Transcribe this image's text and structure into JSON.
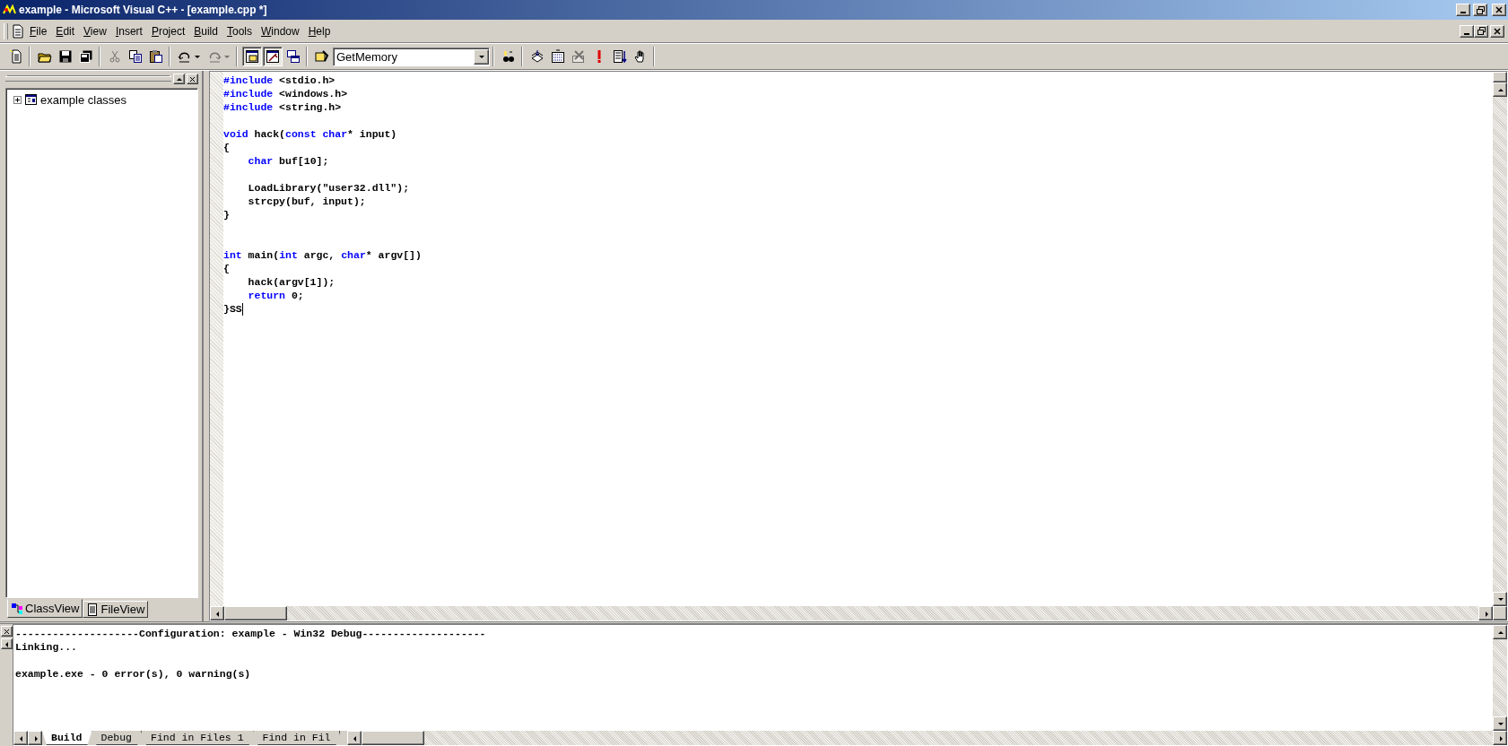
{
  "window": {
    "title": "example - Microsoft Visual C++ - [example.cpp *]"
  },
  "menu": [
    {
      "label": "File"
    },
    {
      "label": "Edit"
    },
    {
      "label": "View"
    },
    {
      "label": "Insert"
    },
    {
      "label": "Project"
    },
    {
      "label": "Build"
    },
    {
      "label": "Tools"
    },
    {
      "label": "Window"
    },
    {
      "label": "Help"
    }
  ],
  "toolbar": {
    "groups": [
      [
        {
          "kind": "button",
          "disabled": false,
          "pressed": false
        }
      ],
      [
        {
          "kind": "button",
          "disabled": false,
          "pressed": false
        },
        {
          "kind": "button",
          "disabled": false,
          "pressed": false
        },
        {
          "kind": "button",
          "disabled": false,
          "pressed": false
        }
      ],
      [
        {
          "kind": "button",
          "disabled": true,
          "pressed": false
        },
        {
          "kind": "button",
          "disabled": false,
          "pressed": false
        },
        {
          "kind": "button",
          "disabled": false,
          "pressed": false
        }
      ],
      [
        {
          "kind": "dropbutton",
          "disabled": false,
          "pressed": false
        },
        {
          "kind": "dropbutton",
          "disabled": true,
          "pressed": false
        }
      ],
      [
        {
          "kind": "button",
          "disabled": false,
          "pressed": true
        },
        {
          "kind": "button",
          "disabled": false,
          "pressed": true
        },
        {
          "kind": "button",
          "disabled": false,
          "pressed": false
        }
      ],
      [
        {
          "kind": "button",
          "disabled": false,
          "pressed": false
        },
        {
          "kind": "combo",
          "value": "GetMemory"
        }
      ],
      [
        {
          "kind": "button",
          "disabled": false,
          "pressed": false
        }
      ],
      [
        {
          "kind": "button",
          "disabled": false,
          "pressed": false
        },
        {
          "kind": "button",
          "disabled": false,
          "pressed": false
        },
        {
          "kind": "button",
          "disabled": true,
          "pressed": false
        },
        {
          "kind": "button",
          "disabled": false,
          "pressed": false
        },
        {
          "kind": "button",
          "disabled": false,
          "pressed": false
        },
        {
          "kind": "button",
          "disabled": false,
          "pressed": false
        }
      ]
    ]
  },
  "workspace": {
    "tree": [
      {
        "label": "example classes",
        "expanded": false
      }
    ],
    "tabs": [
      {
        "label": "ClassView",
        "selected": true
      },
      {
        "label": "FileView",
        "selected": false
      }
    ]
  },
  "editor": {
    "lines": [
      {
        "kind": "code",
        "tokens": [
          {
            "kind": "keyword",
            "text": "#include"
          },
          {
            "kind": "plain",
            "text": " <stdio.h>"
          }
        ]
      },
      {
        "kind": "code",
        "tokens": [
          {
            "kind": "keyword",
            "text": "#include"
          },
          {
            "kind": "plain",
            "text": " <windows.h>"
          }
        ]
      },
      {
        "kind": "code",
        "tokens": [
          {
            "kind": "keyword",
            "text": "#include"
          },
          {
            "kind": "plain",
            "text": " <string.h>"
          }
        ]
      },
      {
        "kind": "blank"
      },
      {
        "kind": "code",
        "tokens": [
          {
            "kind": "keyword",
            "text": "void"
          },
          {
            "kind": "plain",
            "text": " hack("
          },
          {
            "kind": "keyword",
            "text": "const char"
          },
          {
            "kind": "plain",
            "text": "* input)"
          }
        ]
      },
      {
        "kind": "code",
        "tokens": [
          {
            "kind": "plain",
            "text": "{"
          }
        ]
      },
      {
        "kind": "code",
        "tokens": [
          {
            "kind": "keyword",
            "text": "    char"
          },
          {
            "kind": "plain",
            "text": " buf[10];"
          }
        ]
      },
      {
        "kind": "blank"
      },
      {
        "kind": "code",
        "tokens": [
          {
            "kind": "plain",
            "text": "    LoadLibrary(\"user32.dll\");"
          }
        ]
      },
      {
        "kind": "code",
        "tokens": [
          {
            "kind": "plain",
            "text": "    strcpy(buf, input);"
          }
        ]
      },
      {
        "kind": "code",
        "tokens": [
          {
            "kind": "plain",
            "text": "}"
          }
        ]
      },
      {
        "kind": "blank"
      },
      {
        "kind": "blank"
      },
      {
        "kind": "code",
        "tokens": [
          {
            "kind": "keyword",
            "text": "int"
          },
          {
            "kind": "plain",
            "text": " main("
          },
          {
            "kind": "keyword",
            "text": "int"
          },
          {
            "kind": "plain",
            "text": " argc, "
          },
          {
            "kind": "keyword",
            "text": "char"
          },
          {
            "kind": "plain",
            "text": "* argv[])"
          }
        ]
      },
      {
        "kind": "code",
        "tokens": [
          {
            "kind": "plain",
            "text": "{"
          }
        ]
      },
      {
        "kind": "code",
        "tokens": [
          {
            "kind": "plain",
            "text": "    hack(argv[1]);"
          }
        ]
      },
      {
        "kind": "code",
        "tokens": [
          {
            "kind": "keyword",
            "text": "    return"
          },
          {
            "kind": "plain",
            "text": " 0;"
          }
        ]
      },
      {
        "kind": "code",
        "cursor": true,
        "tokens": [
          {
            "kind": "plain",
            "text": "}SS"
          }
        ]
      }
    ]
  },
  "output": {
    "lines": [
      {
        "kind": "text",
        "text": "--------------------Configuration: example - Win32 Debug--------------------"
      },
      {
        "kind": "text",
        "text": "Linking..."
      },
      {
        "kind": "blank"
      },
      {
        "kind": "text",
        "text": "example.exe - 0 error(s), 0 warning(s)"
      }
    ],
    "tabs": [
      {
        "label": "Build",
        "selected": true
      },
      {
        "label": "Debug",
        "selected": false
      },
      {
        "label": "Find in Files 1",
        "selected": false
      },
      {
        "label": "Find in Fil",
        "selected": false
      }
    ]
  }
}
